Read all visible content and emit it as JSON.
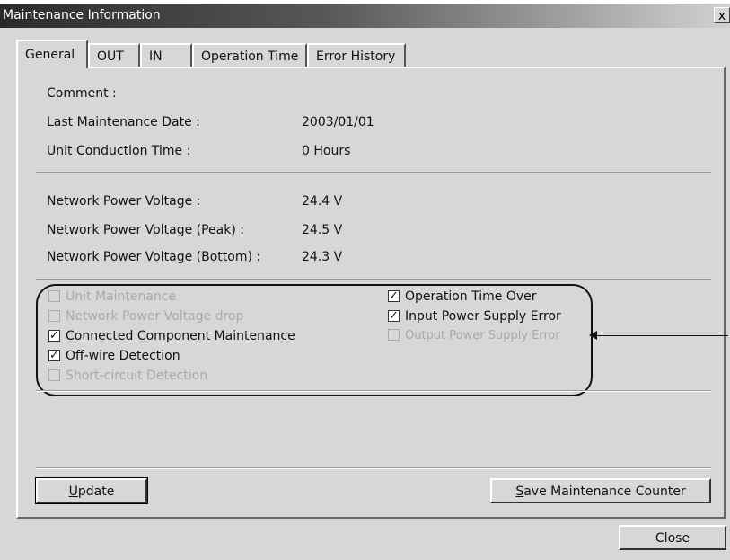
{
  "window": {
    "title": "Maintenance Information",
    "close_glyph": "x"
  },
  "tabs": [
    {
      "label": "General",
      "active": true
    },
    {
      "label": "OUT",
      "active": false
    },
    {
      "label": "IN",
      "active": false
    },
    {
      "label": "Operation Time",
      "active": false
    },
    {
      "label": "Error History",
      "active": false
    }
  ],
  "general": {
    "comment_label": "Comment :",
    "comment_value": "",
    "last_maintenance_label": "Last Maintenance Date :",
    "last_maintenance_value": "2003/01/01",
    "conduction_label": "Unit Conduction Time :",
    "conduction_value": "0 Hours",
    "voltage_label": "Network Power Voltage :",
    "voltage_value": "24.4 V",
    "voltage_peak_label": "Network Power Voltage (Peak) :",
    "voltage_peak_value": "24.5 V",
    "voltage_bottom_label": "Network Power Voltage (Bottom) :",
    "voltage_bottom_value": "24.3 V"
  },
  "status_flags": {
    "left": [
      {
        "label": "Unit Maintenance",
        "checked": false,
        "enabled": false
      },
      {
        "label": "Network Power Voltage drop",
        "checked": false,
        "enabled": false
      },
      {
        "label": "Connected Component Maintenance",
        "checked": true,
        "enabled": true
      },
      {
        "label": "Off-wire Detection",
        "checked": true,
        "enabled": true
      },
      {
        "label": "Short-circuit Detection",
        "checked": false,
        "enabled": false
      }
    ],
    "right": [
      {
        "label": "Operation Time Over",
        "checked": true,
        "enabled": true
      },
      {
        "label": "Input Power Supply Error",
        "checked": true,
        "enabled": true
      },
      {
        "label": "Output Power Supply Error",
        "checked": false,
        "enabled": false
      }
    ],
    "check_glyph": "✓"
  },
  "buttons": {
    "update_accel": "U",
    "update_rest": "pdate",
    "save_accel": "S",
    "save_rest": "ave Maintenance Counter",
    "close": "Close"
  }
}
